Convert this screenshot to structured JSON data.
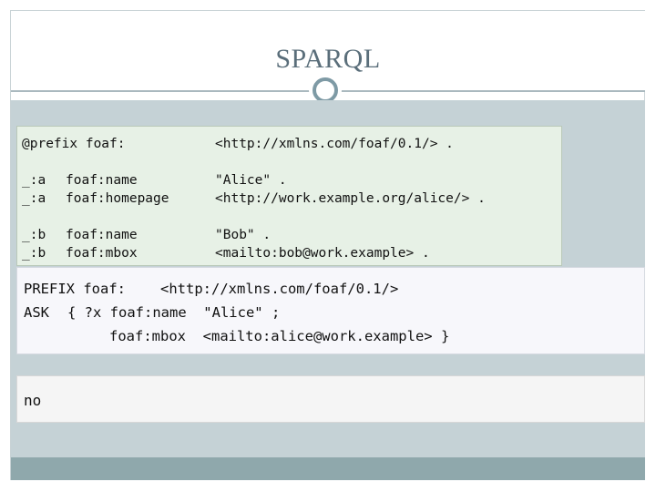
{
  "slide": {
    "title": "SPARQL"
  },
  "data_block": {
    "prefix_line": {
      "keyword": "@prefix foaf:",
      "uri": "<http://xmlns.com/foaf/0.1/> ."
    },
    "triples": [
      {
        "subject": "_:a",
        "predicate": "foaf:name",
        "object": "\"Alice\" ."
      },
      {
        "subject": "_:a",
        "predicate": "foaf:homepage",
        "object": "<http://work.example.org/alice/> ."
      },
      {
        "subject": "_:b",
        "predicate": "foaf:name",
        "object": "\"Bob\" ."
      },
      {
        "subject": "_:b",
        "predicate": "foaf:mbox",
        "object": "<mailto:bob@work.example> ."
      }
    ]
  },
  "query_block": {
    "line1": {
      "keyword": "PREFIX foaf:",
      "rest": "<http://xmlns.com/foaf/0.1/>"
    },
    "line2": {
      "keyword": "ASK",
      "rest": "{ ?x foaf:name  \"Alice\" ;"
    },
    "line3": {
      "rest": "foaf:mbox  <mailto:alice@work.example> }"
    }
  },
  "result_block": {
    "value": "no"
  },
  "colors": {
    "data_bg": "#e7f1e6",
    "query_bg": "#f7f7fb",
    "result_bg": "#f5f5f5",
    "content_bg": "#c5d2d6",
    "band": "#8fa8ac",
    "title_color": "#5a6e7a"
  },
  "icons": {
    "divider": "ring-icon"
  }
}
